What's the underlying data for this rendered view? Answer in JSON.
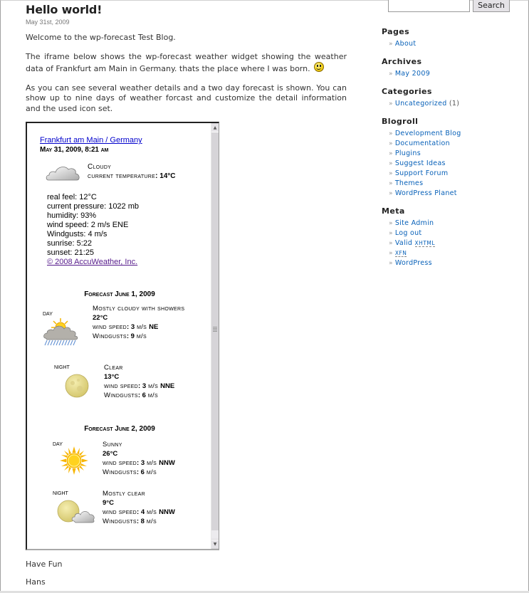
{
  "post": {
    "title": "Hello world!",
    "date": "May 31st, 2009",
    "paragraphs": [
      "Welcome to the wp-forecast Test Blog.",
      "The iframe below shows the wp-forecast weather widget showing the weather data of Frankfurt am Main in Germany. thats the place where I was born.",
      "As you can see several weather details and a two day forecast is shown. You can show up to nine days of weather forcast and customize the detail information and the used icon set."
    ],
    "smiley_icon": "smiley-face-icon",
    "closing": [
      "Have Fun",
      "Hans"
    ]
  },
  "widget": {
    "location_link": "Frankfurt am Main / Germany",
    "datetime": "May 31, 2009, 8:21 am",
    "current": {
      "icon": "cloudy-icon",
      "condition": "Cloudy",
      "temp_label": "current temperature",
      "temp_value": "14°C"
    },
    "details": [
      "real feel: 12°C",
      "current pressure: 1022 mb",
      "humidity: 93%",
      "wind speed: 2 m/s ENE",
      "Windgusts: 4 m/s",
      "sunrise: 5:22",
      "sunset: 21:25"
    ],
    "copyright_link": "© 2008 AccuWeather, Inc.",
    "forecasts": [
      {
        "heading": "Forecast June 1, 2009",
        "day": {
          "label": "day",
          "icon": "cloud-sun-rain-icon",
          "condition": "Mostly cloudy with showers",
          "temp": "22°C",
          "wind_label": "wind speed",
          "wind_value": "3",
          "wind_unit": "m/s",
          "wind_dir": "NE",
          "gust_label": "Windgusts",
          "gust_value": "9",
          "gust_unit": "m/s"
        },
        "night": {
          "label": "night",
          "icon": "moon-icon",
          "condition": "Clear",
          "temp": "13°C",
          "wind_label": "wind speed",
          "wind_value": "3",
          "wind_unit": "m/s",
          "wind_dir": "NNE",
          "gust_label": "Windgusts",
          "gust_value": "6",
          "gust_unit": "m/s"
        }
      },
      {
        "heading": "Forecast June 2, 2009",
        "day": {
          "label": "day",
          "icon": "sun-icon",
          "condition": "Sunny",
          "temp": "26°C",
          "wind_label": "wind speed",
          "wind_value": "3",
          "wind_unit": "m/s",
          "wind_dir": "NNW",
          "gust_label": "Windgusts",
          "gust_value": "6",
          "gust_unit": "m/s"
        },
        "night": {
          "label": "night",
          "icon": "moon-cloud-icon",
          "condition": "Mostly clear",
          "temp": "9°C",
          "wind_label": "wind speed",
          "wind_value": "4",
          "wind_unit": "m/s",
          "wind_dir": "NNW",
          "gust_label": "Windgusts",
          "gust_value": "8",
          "gust_unit": "m/s"
        }
      }
    ]
  },
  "search": {
    "input_value": "",
    "button_label": "Search"
  },
  "sidebar": {
    "sections": [
      {
        "title": "Pages",
        "items": [
          {
            "label": "About"
          }
        ]
      },
      {
        "title": "Archives",
        "items": [
          {
            "label": "May 2009"
          }
        ]
      },
      {
        "title": "Categories",
        "items": [
          {
            "label": "Uncategorized",
            "count": "(1)"
          }
        ]
      },
      {
        "title": "Blogroll",
        "items": [
          {
            "label": "Development Blog"
          },
          {
            "label": "Documentation"
          },
          {
            "label": "Plugins"
          },
          {
            "label": "Suggest Ideas"
          },
          {
            "label": "Support Forum"
          },
          {
            "label": "Themes"
          },
          {
            "label": "WordPress Planet"
          }
        ]
      },
      {
        "title": "Meta",
        "items": [
          {
            "label": "Site Admin"
          },
          {
            "label": "Log out"
          },
          {
            "label": "Valid",
            "abbr": "XHTML"
          },
          {
            "abbr": "XFN"
          },
          {
            "label": "WordPress"
          }
        ]
      }
    ],
    "bullet": "»"
  }
}
